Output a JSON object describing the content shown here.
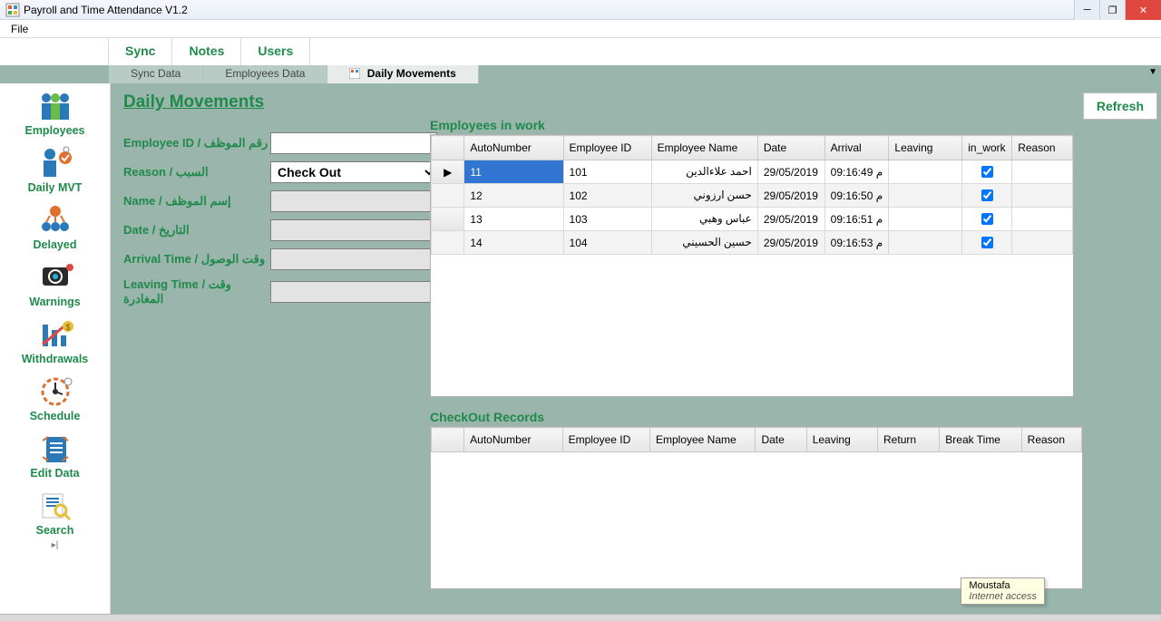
{
  "window": {
    "title": "Payroll and Time Attendance V1.2"
  },
  "menubar": {
    "file": "File"
  },
  "toolbar": {
    "sync": "Sync",
    "notes": "Notes",
    "users": "Users"
  },
  "tabs": [
    {
      "label": "Sync Data",
      "active": false
    },
    {
      "label": "Employees Data",
      "active": false
    },
    {
      "label": "Daily Movements",
      "active": true
    }
  ],
  "sidebar": {
    "items": [
      {
        "label": "Employees"
      },
      {
        "label": "Daily MVT"
      },
      {
        "label": "Delayed"
      },
      {
        "label": "Warnings"
      },
      {
        "label": "Withdrawals"
      },
      {
        "label": "Schedule"
      },
      {
        "label": "Edit Data"
      },
      {
        "label": "Search"
      }
    ]
  },
  "page": {
    "title": "Daily Movements",
    "refresh": "Refresh"
  },
  "form": {
    "employee_id_label": "Employee ID / رقم الموظف",
    "reason_label": "Reason / السبب",
    "reason_value": "Check Out",
    "name_label": "Name / إسم الموظف",
    "date_label": "Date / التاريخ",
    "arrival_label": "Arrival Time / وقت الوصول",
    "leaving_label": "Leaving Time / وقت المغادرة"
  },
  "section1": {
    "title": "Employees in work",
    "columns": [
      "",
      "AutoNumber",
      "Employee ID",
      "Employee Name",
      "Date",
      "Arrival",
      "Leaving",
      "in_work",
      "Reason"
    ],
    "rows": [
      {
        "auto": "11",
        "empid": "101",
        "name": "احمد علاءالدين",
        "date": "29/05/2019",
        "arrival": "م 09:16:49",
        "leaving": "",
        "in_work": true,
        "reason": ""
      },
      {
        "auto": "12",
        "empid": "102",
        "name": "حسن ارزوني",
        "date": "29/05/2019",
        "arrival": "م 09:16:50",
        "leaving": "",
        "in_work": true,
        "reason": ""
      },
      {
        "auto": "13",
        "empid": "103",
        "name": "عباس وهبي",
        "date": "29/05/2019",
        "arrival": "م 09:16:51",
        "leaving": "",
        "in_work": true,
        "reason": ""
      },
      {
        "auto": "14",
        "empid": "104",
        "name": "حسين الحسيني",
        "date": "29/05/2019",
        "arrival": "م 09:16:53",
        "leaving": "",
        "in_work": true,
        "reason": ""
      }
    ],
    "selected_row": 0
  },
  "section2": {
    "title": "CheckOut Records",
    "columns": [
      "",
      "AutoNumber",
      "Employee ID",
      "Employee Name",
      "Date",
      "Leaving",
      "Return",
      "Break Time",
      "Reason"
    ],
    "rows": []
  },
  "tooltip": {
    "line1": "Moustafa",
    "line2": "Internet access"
  }
}
